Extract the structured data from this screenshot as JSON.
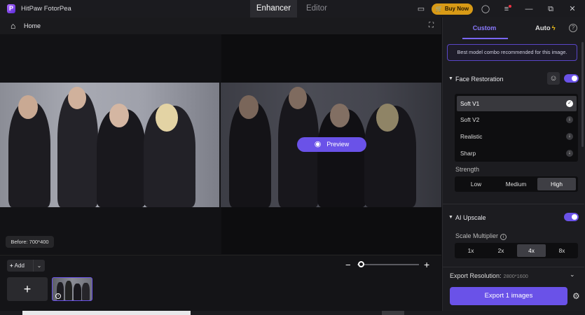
{
  "app": {
    "logo_text": "P",
    "title": "HitPaw FotorPea"
  },
  "tabs": {
    "enhancer": "Enhancer",
    "editor": "Editor"
  },
  "titlebar": {
    "buy_now": "Buy Now",
    "icons": [
      "feedback-icon",
      "account-icon",
      "menu-icon",
      "minimize-icon",
      "maximize-icon",
      "close-icon"
    ]
  },
  "nav": {
    "home_label": "Home"
  },
  "canvas": {
    "preview_label": "Preview",
    "before_badge": "Before: 700*400"
  },
  "bottom": {
    "add_label": "Add",
    "zoom_percent": 0
  },
  "panel": {
    "tab_custom": "Custom",
    "tab_auto": "Auto",
    "recommendation": "Best model combo recommended for this image.",
    "face_restoration": {
      "title": "Face Restoration",
      "enabled": true,
      "models": [
        {
          "label": "Soft V1",
          "selected": true
        },
        {
          "label": "Soft V2",
          "selected": false
        },
        {
          "label": "Realistic",
          "selected": false
        },
        {
          "label": "Sharp",
          "selected": false
        }
      ],
      "strength_label": "Strength",
      "strength_options": [
        "Low",
        "Medium",
        "High"
      ],
      "strength_selected": "High"
    },
    "ai_upscale": {
      "title": "AI Upscale",
      "enabled": true,
      "scale_label": "Scale Multiplier",
      "scale_options": [
        "1x",
        "2x",
        "4x",
        "8x"
      ],
      "scale_selected": "4x"
    },
    "export": {
      "resolution_label": "Export Resolution:",
      "resolution_value": "2800*1600",
      "button": "Export 1 images"
    }
  },
  "colors": {
    "accent": "#6a52e8",
    "buy_now": "#d89a16",
    "panel_bg": "#1c1c20"
  }
}
